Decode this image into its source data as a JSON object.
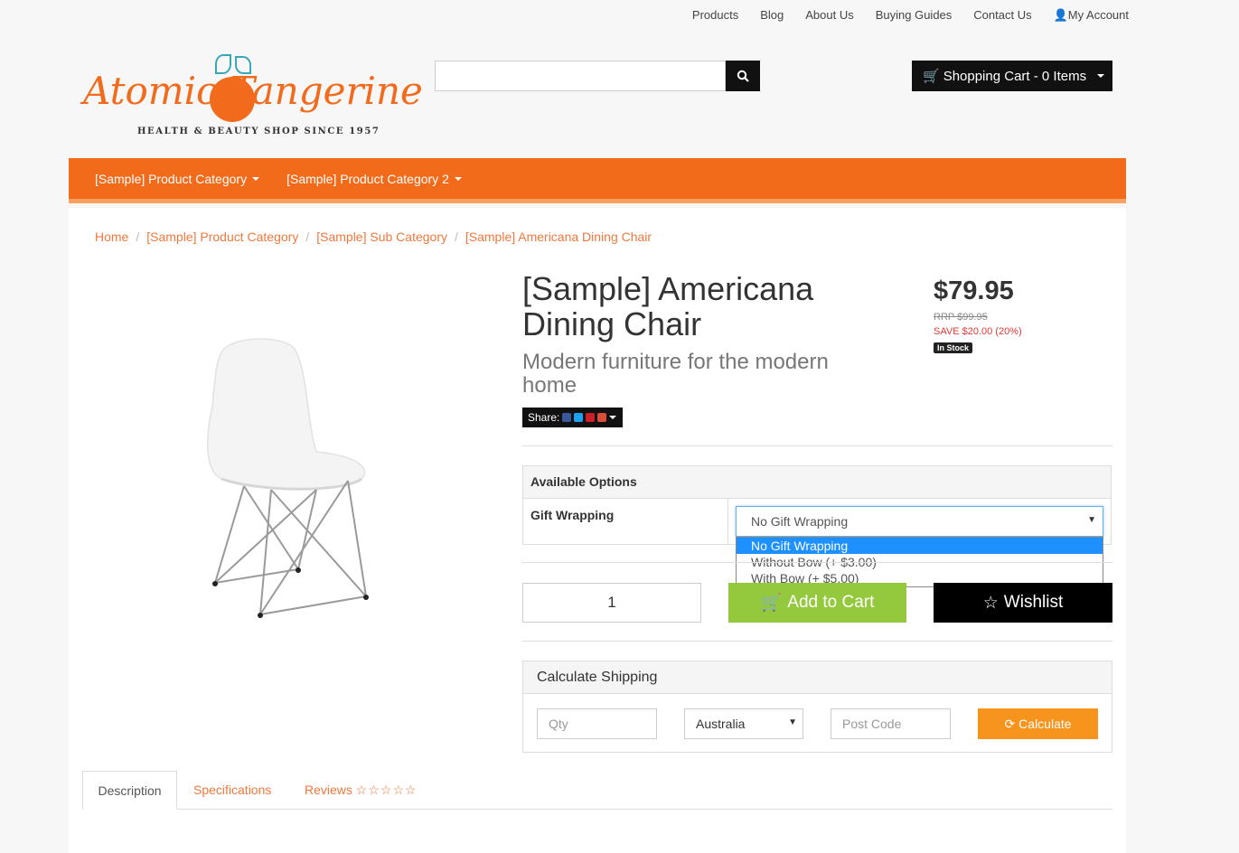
{
  "top_links": [
    "Products",
    "Blog",
    "About Us",
    "Buying Guides",
    "Contact Us",
    "My Account"
  ],
  "logo": {
    "name": "Atomic Tangerine",
    "tagline": "HEALTH & BEAUTY SHOP SINCE 1957"
  },
  "search": {
    "value": ""
  },
  "cart": {
    "label": "Shopping Cart - 0 Items"
  },
  "nav": {
    "items": [
      "[Sample] Product Category",
      "[Sample] Product Category 2"
    ]
  },
  "breadcrumb": [
    "Home",
    "[Sample] Product Category",
    "[Sample] Sub Category",
    "[Sample] Americana Dining Chair"
  ],
  "product": {
    "title": "[Sample] Americana Dining Chair",
    "subtitle": "Modern furniture for the modern home",
    "share_label": "Share:",
    "price": "$79.95",
    "rrp": "RRP $99.95",
    "save": "SAVE $20.00 (20%)",
    "stock": "In Stock"
  },
  "options": {
    "heading": "Available Options",
    "gift_label": "Gift Wrapping",
    "selected": "No Gift Wrapping",
    "choices": [
      "No Gift Wrapping",
      "Without Bow (+ $3.00)",
      "With Bow (+ $5.00)"
    ]
  },
  "purchase": {
    "qty": "1",
    "add_label": "Add to Cart",
    "wishlist_label": "Wishlist"
  },
  "shipping": {
    "heading": "Calculate Shipping",
    "qty_placeholder": "Qty",
    "country": "Australia",
    "postcode_placeholder": "Post Code",
    "calc_label": "Calculate"
  },
  "tabs": {
    "description": "Description",
    "specifications": "Specifications",
    "reviews": "Reviews",
    "review_stars": "☆☆☆☆☆"
  },
  "colors": {
    "brand_orange": "#f26b1a",
    "add_green": "#95c93d",
    "calc_orange": "#f7941d",
    "link_orange": "#f0783c"
  }
}
